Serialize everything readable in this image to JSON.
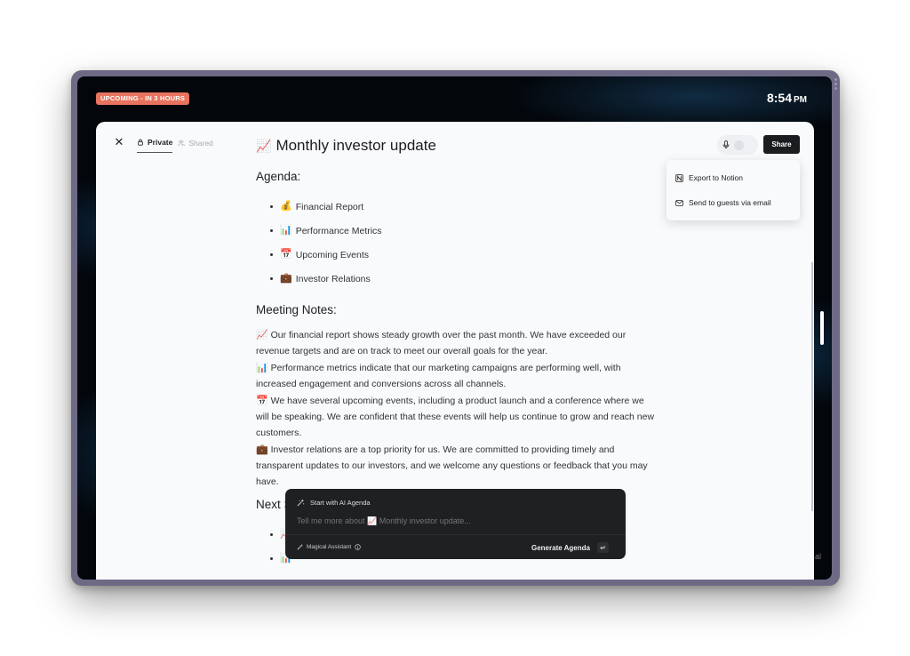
{
  "status_bar": {
    "upcoming_badge": "UPCOMING - IN 3 HOURS",
    "time": "8:54",
    "ampm": "PM"
  },
  "panel": {
    "tabs": [
      {
        "label": "Private",
        "icon": "lock-icon",
        "active": true
      },
      {
        "label": "Shared",
        "icon": "users-icon",
        "active": false
      }
    ],
    "title_emoji": "📈",
    "title": "Monthly investor update",
    "share_label": "Share",
    "share_menu": [
      {
        "label": "Export to Notion",
        "icon": "notion-icon"
      },
      {
        "label": "Send to guests via email",
        "icon": "mail-icon"
      }
    ]
  },
  "document": {
    "agenda_heading": "Agenda:",
    "agenda_items": [
      {
        "emoji": "💰",
        "text": "Financial Report"
      },
      {
        "emoji": "📊",
        "text": "Performance Metrics"
      },
      {
        "emoji": "📅",
        "text": "Upcoming Events"
      },
      {
        "emoji": "💼",
        "text": "Investor Relations"
      }
    ],
    "notes_heading": "Meeting Notes:",
    "notes": [
      {
        "emoji": "📈",
        "text": "Our financial report shows steady growth over the past month. We have exceeded our revenue targets and are on track to meet our overall goals for the year."
      },
      {
        "emoji": "📊",
        "text": "Performance metrics indicate that our marketing campaigns are performing well, with increased engagement and conversions across all channels."
      },
      {
        "emoji": "📅",
        "text": "We have several upcoming events, including a product launch and a conference where we will be speaking. We are confident that these events will help us continue to grow and reach new customers."
      },
      {
        "emoji": "💼",
        "text": "Investor relations are a top priority for us. We are committed to providing timely and transparent updates to our investors, and we welcome any questions or feedback that you may have."
      }
    ],
    "next_heading": "Next S",
    "next_items": [
      {
        "emoji": "📈"
      },
      {
        "emoji": "📊"
      }
    ]
  },
  "ai_assistant": {
    "header": "Start with AI Agenda",
    "placeholder": "Tell me more about 📈 Monthly investor update...",
    "footer_label": "Magical Assistant",
    "generate_label": "Generate Agenda",
    "enter_key": "↵"
  },
  "background": {
    "bottom_right_fragment": "al"
  }
}
